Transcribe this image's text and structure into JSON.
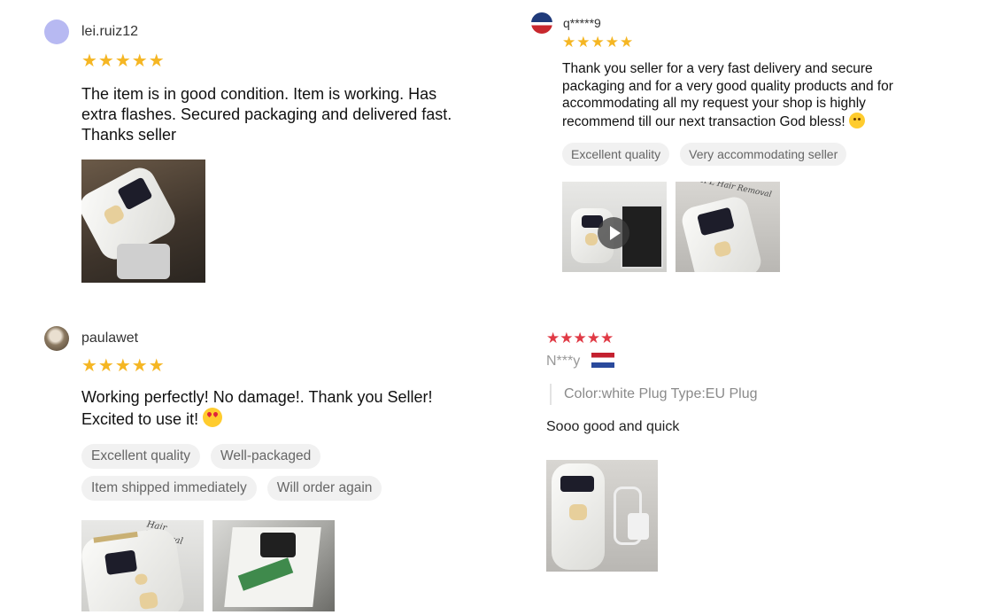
{
  "reviews": [
    {
      "username": "lei.ruiz12",
      "stars": "★★★★★",
      "text": "The item is in good condition. Item is working. Has extra flashes. Secured packaging and delivered fast. Thanks seller"
    },
    {
      "username": "q*****9",
      "stars": "★★★★★",
      "text": "Thank you seller for a very fast delivery and secure packaging and for a very good quality products and for accommodating all my request your shop is highly recommend till our next transaction God bless!",
      "tags": [
        "Excellent quality",
        "Very accommodating seller"
      ],
      "photo_label": "IPL Hair Removal"
    },
    {
      "username": "paulawet",
      "stars": "★★★★★",
      "text": "Working perfectly! No damage!. Thank you Seller! Excited to use it!",
      "tags": [
        "Excellent quality",
        "Well-packaged",
        "Item shipped immediately",
        "Will order again"
      ],
      "photo_label": "Hair Removal"
    },
    {
      "username": "N***y",
      "stars": "★★★★★",
      "variation": "Color:white Plug Type:EU Plug",
      "text": "Sooo good and quick"
    }
  ],
  "colors": {
    "star_gold": "#f5b623",
    "star_red": "#e03a45",
    "tag_bg": "#f1f1f1"
  },
  "icons": {
    "play": "play-icon",
    "flag": "netherlands-flag-icon"
  }
}
